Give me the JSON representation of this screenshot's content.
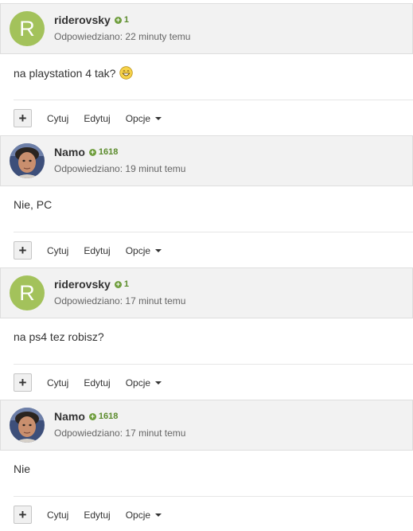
{
  "posts": [
    {
      "author": "riderovsky",
      "avatar_type": "letter",
      "avatar_letter": "R",
      "reputation": "1",
      "date": "Odpowiedziano: 22 minuty temu",
      "body": "na playstation 4 tak?",
      "has_emoji": true
    },
    {
      "author": "Namo",
      "avatar_type": "photo",
      "avatar_letter": "",
      "reputation": "1618",
      "date": "Odpowiedziano: 19 minut temu",
      "body": "Nie, PC",
      "has_emoji": false
    },
    {
      "author": "riderovsky",
      "avatar_type": "letter",
      "avatar_letter": "R",
      "reputation": "1",
      "date": "Odpowiedziano: 17 minut temu",
      "body": "na ps4 tez robisz?",
      "has_emoji": false
    },
    {
      "author": "Namo",
      "avatar_type": "photo",
      "avatar_letter": "",
      "reputation": "1618",
      "date": "Odpowiedziano: 17 minut temu",
      "body": "Nie",
      "has_emoji": false
    }
  ],
  "actions": {
    "plus_label": "+",
    "quote_label": "Cytuj",
    "edit_label": "Edytuj",
    "options_label": "Opcje"
  },
  "colors": {
    "header_bg": "#f2f2f2",
    "letter_avatar_bg": "#a3c25b",
    "reputation_green": "#5b8b2c"
  }
}
